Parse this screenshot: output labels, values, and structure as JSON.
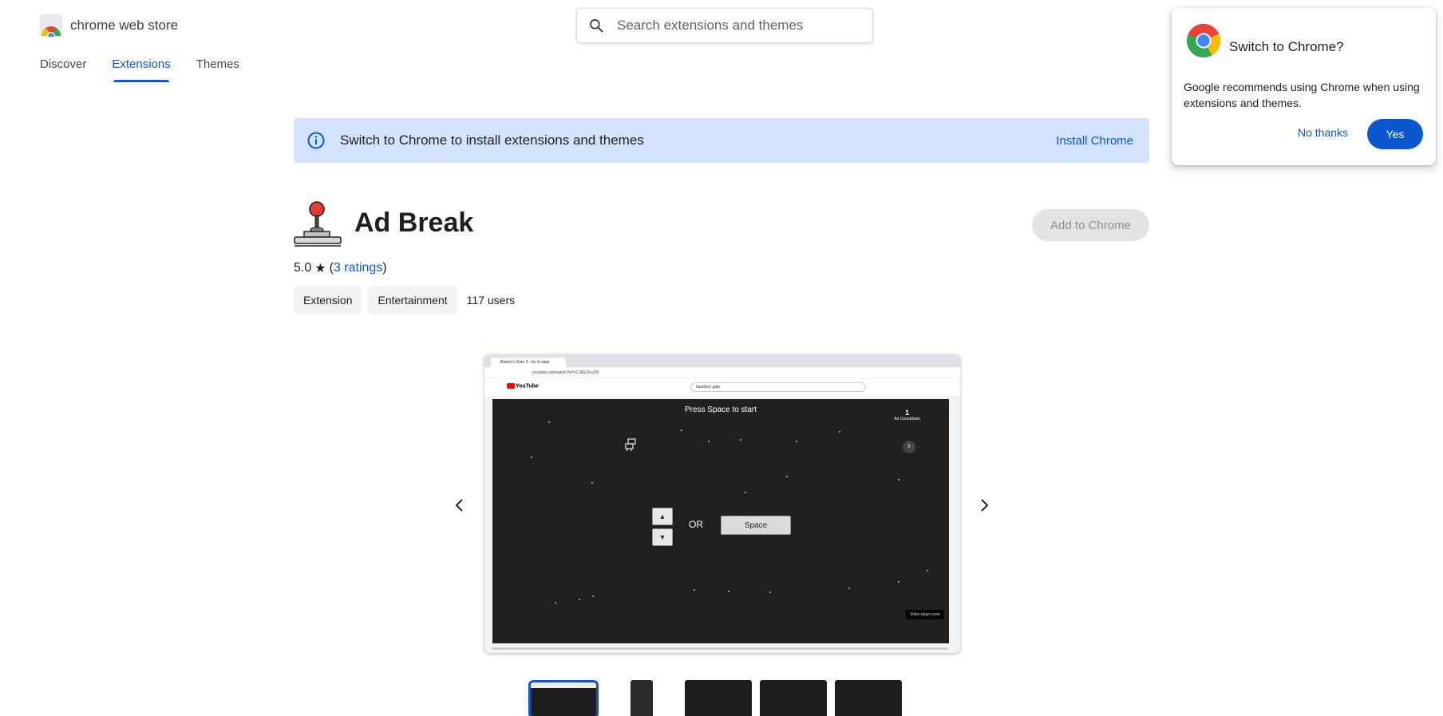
{
  "header": {
    "logo_text": "chrome web store",
    "search_placeholder": "Search extensions and themes"
  },
  "nav": {
    "tabs": [
      {
        "label": "Discover",
        "active": false
      },
      {
        "label": "Extensions",
        "active": true
      },
      {
        "label": "Themes",
        "active": false
      }
    ]
  },
  "banner": {
    "text": "Switch to Chrome to install extensions and themes",
    "link": "Install Chrome"
  },
  "extension": {
    "title": "Ad Break",
    "add_button": "Add to Chrome",
    "rating_value": "5.0",
    "ratings_link": "3 ratings",
    "chips": [
      "Extension",
      "Entertainment"
    ],
    "users": "117 users"
  },
  "screenshot": {
    "browser_tab": "Baldur's Gate 3 - An In-dept",
    "url": "youtube.com/watch?v=VCJEEOroZM",
    "yt_logo": "YouTube",
    "yt_search": "baulders gate",
    "press_text": "Press Space to start",
    "key_up": "▲",
    "key_down": "▼",
    "or_text": "OR",
    "space_key": "Space",
    "countdown_value": "1",
    "countdown_label": "Ad Countdown",
    "pause": "II",
    "video_note": "Video plays soon"
  },
  "popup": {
    "title": "Switch to Chrome?",
    "body": "Google recommends using Chrome when using extensions and themes.",
    "no_thanks": "No thanks",
    "yes": "Yes"
  },
  "colors": {
    "accent": "#0b57d0",
    "banner_bg": "#d3e3fd",
    "game_bg": "#202020"
  }
}
